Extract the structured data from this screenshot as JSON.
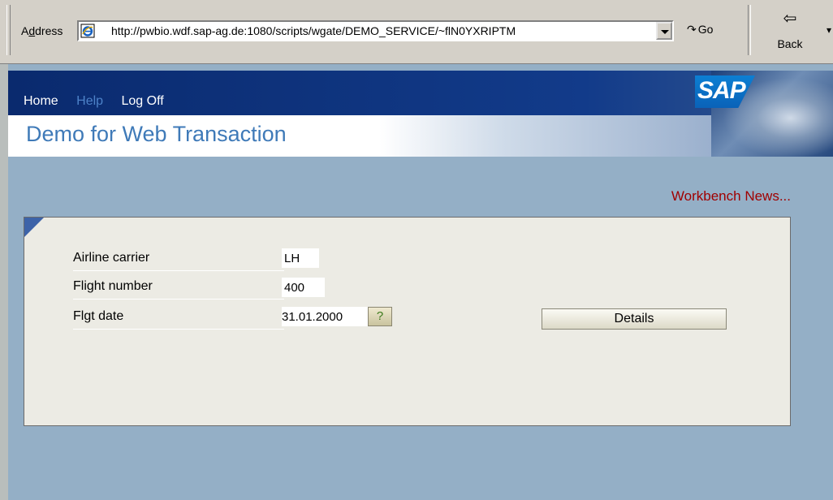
{
  "browser": {
    "address_label": "Address",
    "address_access_key": "d",
    "url": "http://pwbio.wdf.sap-ag.de:1080/scripts/wgate/DEMO_SERVICE/~flN0YXRIPTM",
    "go_label": "Go",
    "back_label": "Back"
  },
  "header": {
    "nav": [
      {
        "label": "Home"
      },
      {
        "label": "Help"
      },
      {
        "label": "Log Off"
      }
    ],
    "title": "Demo for Web Transaction",
    "logo_text": "SAP"
  },
  "news_link": "Workbench News...",
  "form": {
    "fields": [
      {
        "label": "Airline carrier",
        "value": "LH"
      },
      {
        "label": "Flight number",
        "value": "400"
      },
      {
        "label": "Flgt date",
        "value": "31.01.2000"
      }
    ],
    "help_button": "?",
    "details_button": "Details"
  },
  "icons": {
    "browser_page": "ie-page-icon",
    "go": "go-arrow-icon",
    "back": "back-arrow-icon",
    "dropdown": "chevron-down-icon"
  },
  "colors": {
    "header_navy": "#0a2a6e",
    "title_blue": "#3f7ab8",
    "page_bg": "#94afc6",
    "panel_bg": "#ecebe4",
    "news_red": "#a00000"
  }
}
